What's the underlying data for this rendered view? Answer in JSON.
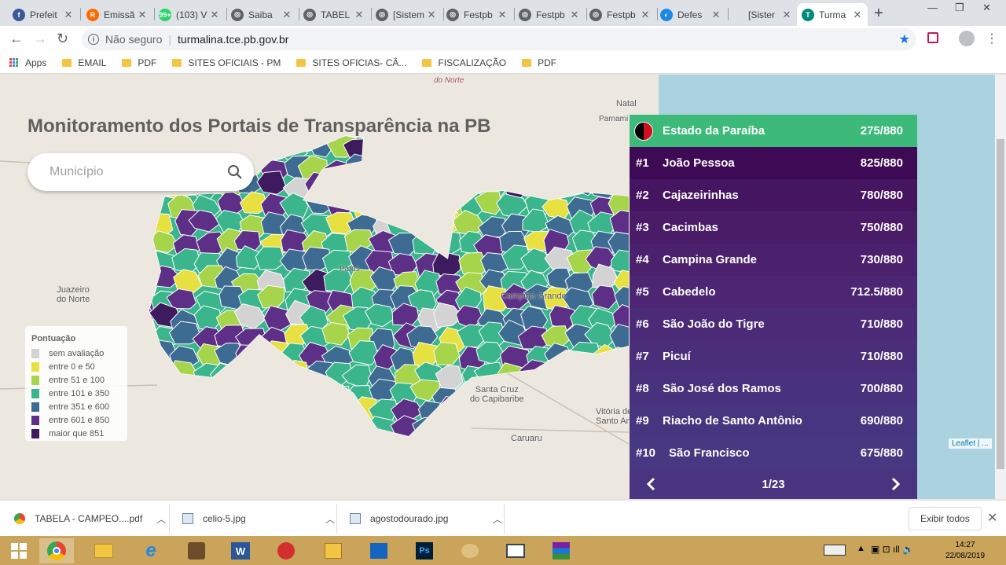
{
  "browser": {
    "tabs": [
      {
        "title": "Prefeit",
        "color": "#3b5998",
        "glyph": "f"
      },
      {
        "title": "Emissã",
        "color": "#ff6a00",
        "glyph": "R"
      },
      {
        "title": "(103) V",
        "color": "#25d366",
        "glyph": "99+"
      },
      {
        "title": "Saiba",
        "color": "#5f6368",
        "glyph": "◎"
      },
      {
        "title": "TABEL",
        "color": "#5f6368",
        "glyph": "◎"
      },
      {
        "title": "[Sistem",
        "color": "#5f6368",
        "glyph": "◎"
      },
      {
        "title": "Festpb",
        "color": "#5f6368",
        "glyph": "◎"
      },
      {
        "title": "Festpb",
        "color": "#5f6368",
        "glyph": "◎"
      },
      {
        "title": "Festpb",
        "color": "#5f6368",
        "glyph": "◎"
      },
      {
        "title": "Defes",
        "color": "#1e88e5",
        "glyph": "◐"
      },
      {
        "title": "[Sister",
        "color": "#dee1e6",
        "glyph": ""
      },
      {
        "title": "Turma",
        "color": "#00897b",
        "glyph": "T"
      }
    ],
    "security": "Não seguro",
    "url": "turmalina.tce.pb.gov.br",
    "bookmarks": [
      "Apps",
      "EMAIL",
      "PDF",
      "SITES OFICIAIS - PM",
      "SITES OFICIAS- CÂ...",
      "FISCALIZAÇÃO",
      "PDF"
    ]
  },
  "page": {
    "title": "Monitoramento dos Portais de Transparência na PB",
    "search_placeholder": "Município",
    "map_labels": {
      "natal": "Natal",
      "parnamirim": "Parnami",
      "juazeiro": "Juazeiro\ndo Norte",
      "patos": "Patos",
      "campina": "Campina Grande",
      "santa_cruz": "Santa Cruz\ndo Capibaribe",
      "caruaru": "Caruaru",
      "vitoria": "Vitória de\nSanto Antã",
      "rio_norte": "do Norte"
    },
    "legend": {
      "title": "Pontuação",
      "items": [
        {
          "label": "sem avaliação",
          "color": "#d3d3d3"
        },
        {
          "label": "entre 0 e 50",
          "color": "#e6e040"
        },
        {
          "label": "entre 51 e 100",
          "color": "#a6d44a"
        },
        {
          "label": "entre 101 e 350",
          "color": "#3bb58b"
        },
        {
          "label": "entre 351 e 600",
          "color": "#3e6b92"
        },
        {
          "label": "entre 601 e 850",
          "color": "#5e2f86"
        },
        {
          "label": "maior que 851",
          "color": "#3e1b5e"
        }
      ]
    },
    "ranking": {
      "state": {
        "name": "Estado da Paraíba",
        "score": "275/880"
      },
      "items": [
        {
          "rank": "#1",
          "name": "João Pessoa",
          "score": "825/880",
          "color": "#3f0a55"
        },
        {
          "rank": "#2",
          "name": "Cajazeirinhas",
          "score": "780/880",
          "color": "#461561"
        },
        {
          "rank": "#3",
          "name": "Cacimbas",
          "score": "750/880",
          "color": "#4a1c68"
        },
        {
          "rank": "#4",
          "name": "Campina Grande",
          "score": "730/880",
          "color": "#4b216e"
        },
        {
          "rank": "#5",
          "name": "Cabedelo",
          "score": "712.5/880",
          "color": "#4c2673"
        },
        {
          "rank": "#6",
          "name": "São João do Tigre",
          "score": "710/880",
          "color": "#4b2a77"
        },
        {
          "rank": "#7",
          "name": "Picuí",
          "score": "710/880",
          "color": "#4a2e7a"
        },
        {
          "rank": "#8",
          "name": "São José dos Ramos",
          "score": "700/880",
          "color": "#48327d"
        },
        {
          "rank": "#9",
          "name": "Riacho de Santo Antônio",
          "score": "690/880",
          "color": "#47357f"
        },
        {
          "rank": "#10",
          "name": "São Francisco",
          "score": "675/880",
          "color": "#463981"
        }
      ],
      "page": "1/23"
    },
    "attribution": "Leaflet | ..."
  },
  "downloads": [
    {
      "name": "TABELA - CAMPEO....pdf"
    },
    {
      "name": "celio-5.jpg"
    },
    {
      "name": "agostodourado.jpg"
    }
  ],
  "downloads_showall": "Exibir todos",
  "taskbar": {
    "time": "14:27",
    "date": "22/08/2019"
  }
}
